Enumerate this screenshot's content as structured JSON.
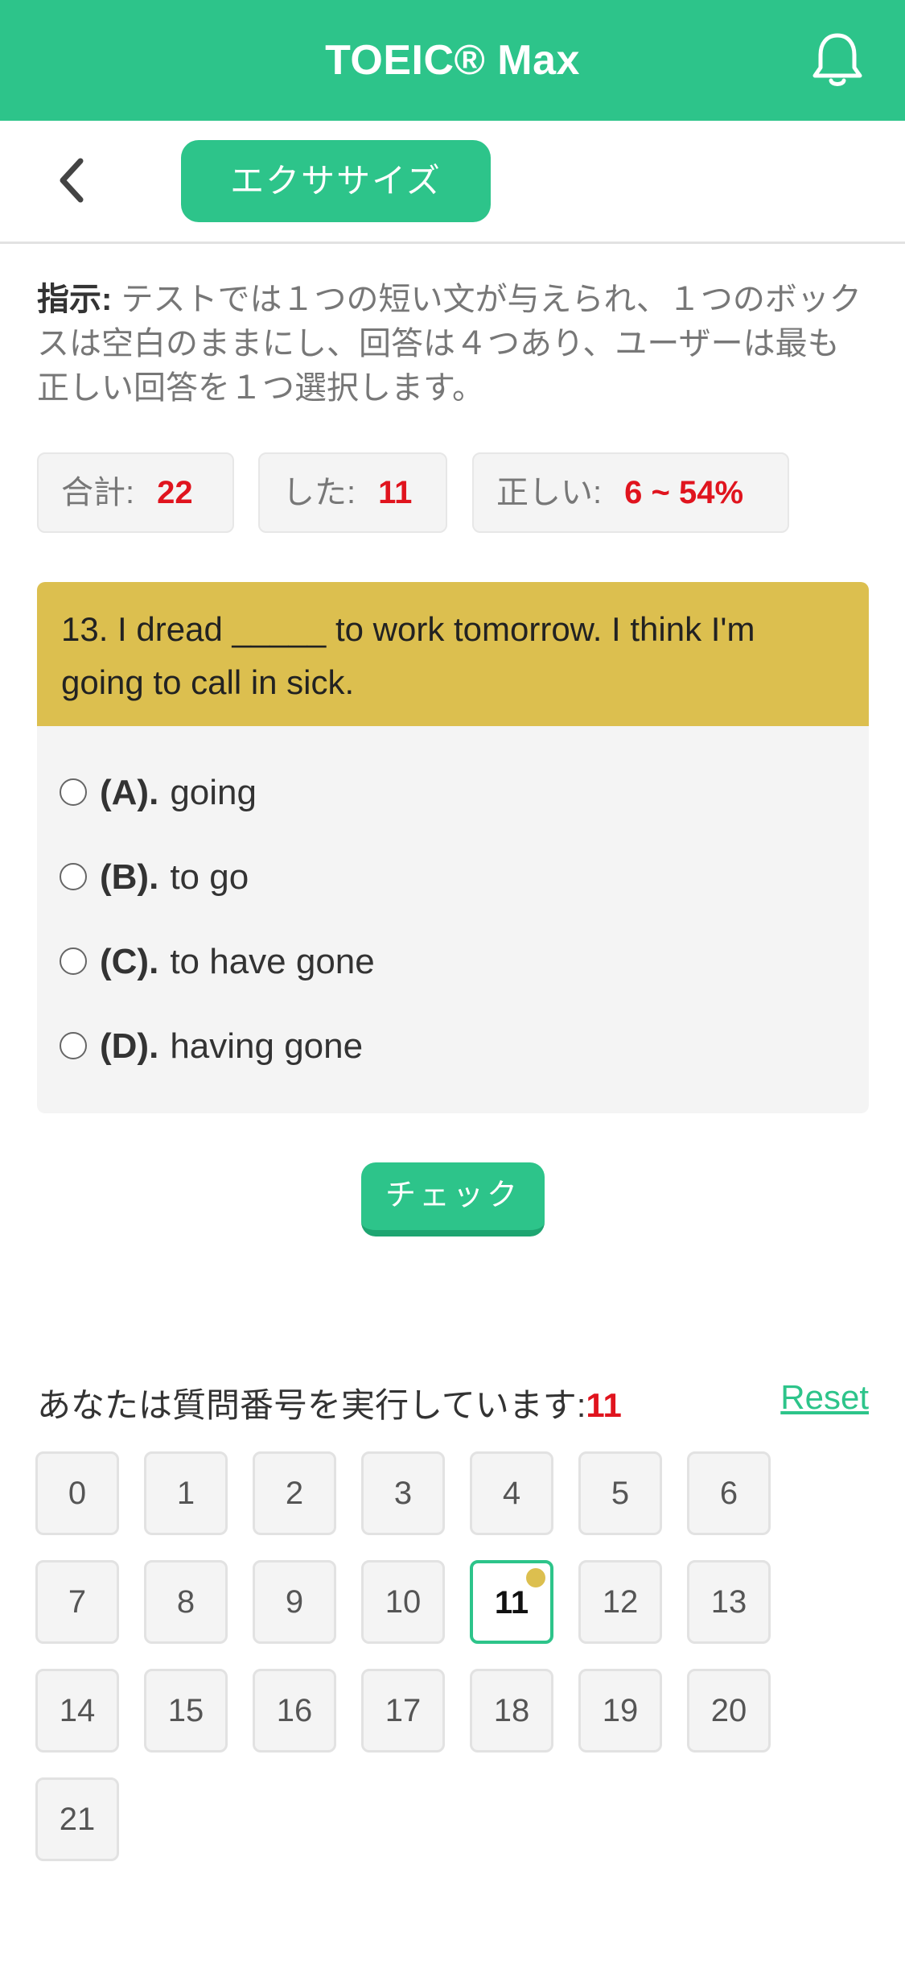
{
  "header": {
    "title": "TOEIC® Max"
  },
  "nav": {
    "tab_label": "エクササイズ"
  },
  "instructions": {
    "label": "指示:",
    "text": " テストでは１つの短い文が与えられ、１つのボックスは空白のままにし、回答は４つあり、ユーザーは最も正しい回答を１つ選択します。"
  },
  "stats": {
    "total_label": "合計:",
    "total_value": "22",
    "done_label": "した:",
    "done_value": "11",
    "correct_label": "正しい:",
    "correct_value": "6 ~ 54%"
  },
  "question": {
    "text": "13. I dread _____ to work tomorrow. I think I'm going to call in sick.",
    "options": [
      {
        "letter": "(A).",
        "text": "going"
      },
      {
        "letter": "(B).",
        "text": "to go"
      },
      {
        "letter": "(C).",
        "text": "to have gone"
      },
      {
        "letter": "(D).",
        "text": "having gone"
      }
    ]
  },
  "check_label": "チェック",
  "progress": {
    "label": "あなたは質問番号を実行しています:",
    "current": "11",
    "reset_label": "Reset"
  },
  "question_numbers": [
    "0",
    "1",
    "2",
    "3",
    "4",
    "5",
    "6",
    "7",
    "8",
    "9",
    "10",
    "11",
    "12",
    "13",
    "14",
    "15",
    "16",
    "17",
    "18",
    "19",
    "20",
    "21"
  ],
  "current_index": 11,
  "colors": {
    "brand": "#2dc48a",
    "question_head": "#dcbf4f",
    "accent_red": "#e0141e"
  },
  "icons": {
    "bell": "bell-icon",
    "back": "chevron-left-icon"
  }
}
